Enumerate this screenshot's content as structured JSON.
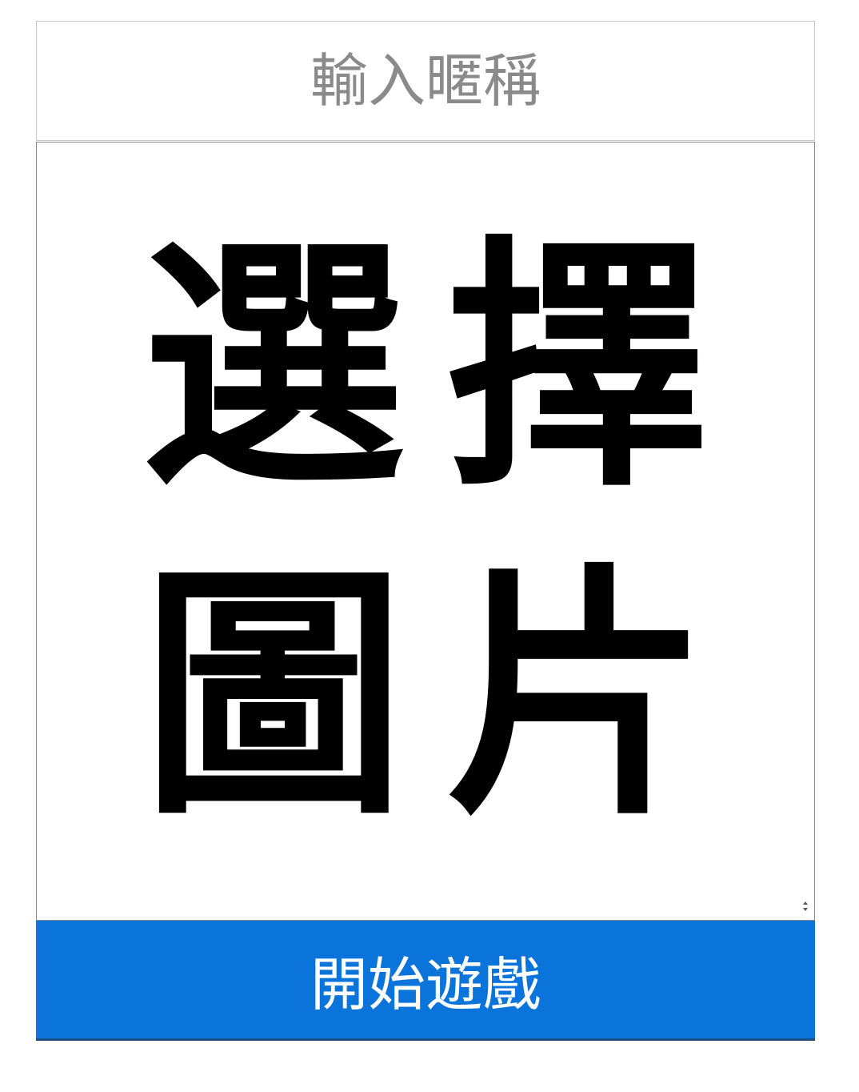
{
  "nickname": {
    "placeholder": "輸入暱稱",
    "value": ""
  },
  "image_select": {
    "label_chars": [
      "選",
      "擇",
      "圖",
      "片"
    ],
    "label": "選擇圖片",
    "stepper_icon": "up-down-arrows-icon"
  },
  "start_button": {
    "label": "開始遊戲"
  },
  "colors": {
    "button_bg": "#0a74da",
    "button_text": "#ffffff",
    "placeholder_text": "#8a8a8a",
    "label_text": "#000000"
  }
}
